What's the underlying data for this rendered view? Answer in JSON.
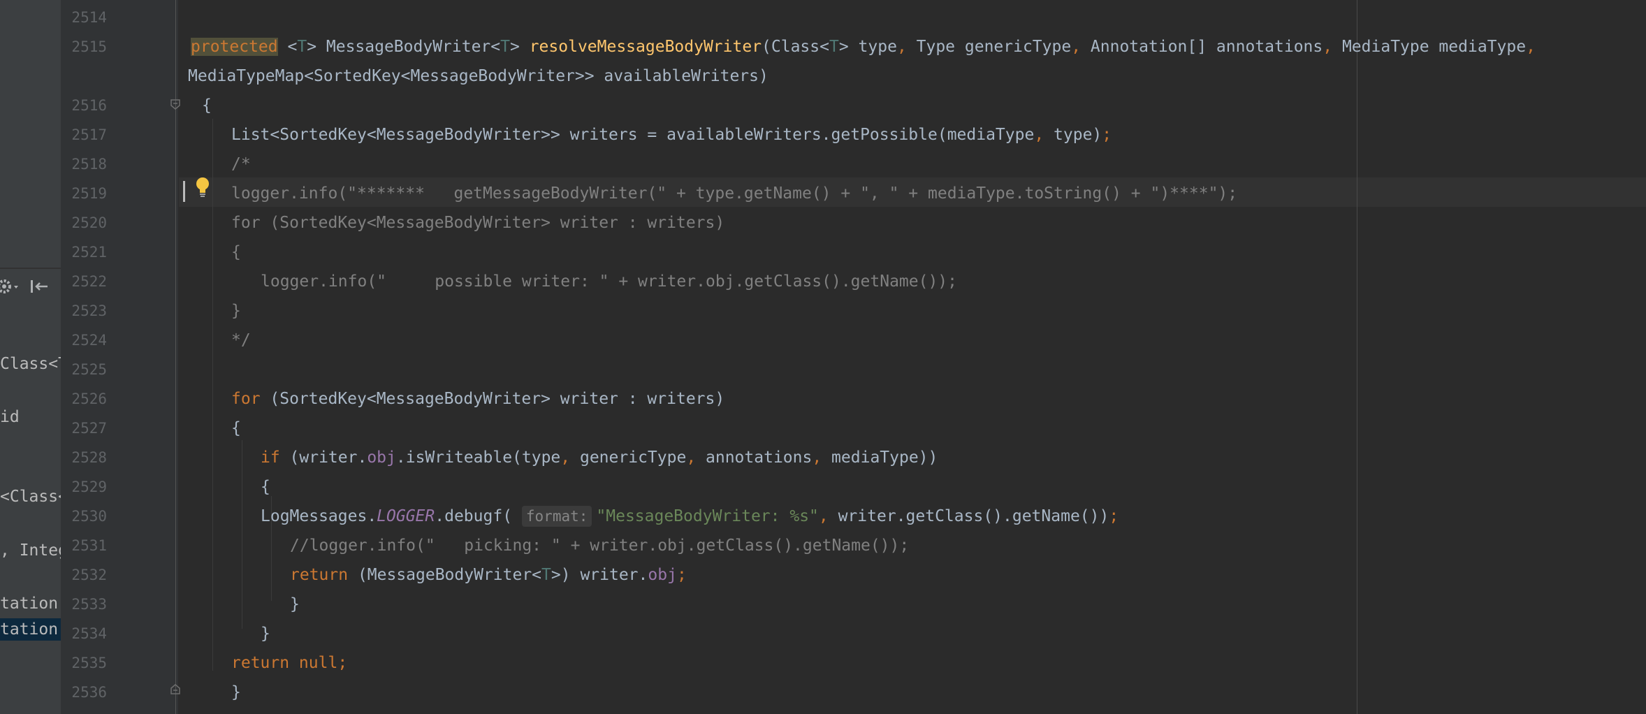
{
  "side_panel": {
    "items": [
      {
        "text": "Class<T"
      },
      {
        "text": "id"
      },
      {
        "text": "<Class<"
      },
      {
        "text": ", Integ"
      },
      {
        "text": "tation["
      },
      {
        "text": "tation["
      }
    ],
    "toolbar": {
      "settings_icon": "gear-icon",
      "collapse_icon": "collapse-left-icon"
    }
  },
  "editor": {
    "current_line": "2519",
    "lines": [
      {
        "num": "2514"
      },
      {
        "num": "2515",
        "tokens": [
          {
            "t": "protected",
            "c": "kw-hl"
          },
          {
            "t": " <",
            "c": ""
          },
          {
            "t": "T",
            "c": "tp"
          },
          {
            "t": "> MessageBodyWriter<",
            "c": ""
          },
          {
            "t": "T",
            "c": "tp"
          },
          {
            "t": "> ",
            "c": ""
          },
          {
            "t": "resolveMessageBodyWriter",
            "c": "fn"
          },
          {
            "t": "(Class<",
            "c": ""
          },
          {
            "t": "T",
            "c": "tp"
          },
          {
            "t": "> type",
            "c": ""
          },
          {
            "t": ",",
            "c": "kw"
          },
          {
            "t": " Type genericType",
            "c": ""
          },
          {
            "t": ",",
            "c": "kw"
          },
          {
            "t": " Annotation[] annotations",
            "c": ""
          },
          {
            "t": ",",
            "c": "kw"
          },
          {
            "t": " MediaType mediaType",
            "c": ""
          },
          {
            "t": ",",
            "c": "kw"
          }
        ]
      },
      {
        "num": "",
        "tokens": [
          {
            "t": "MediaTypeMap<SortedKey<MessageBodyWriter>> availableWriters)",
            "c": ""
          }
        ]
      },
      {
        "num": "2516",
        "tokens": [
          {
            "t": "{",
            "c": ""
          }
        ]
      },
      {
        "num": "2517",
        "tokens": [
          {
            "t": "List<SortedKey<MessageBodyWriter>> writers = availableWriters.getPossible(mediaType",
            "c": ""
          },
          {
            "t": ",",
            "c": "kw"
          },
          {
            "t": " type)",
            "c": ""
          },
          {
            "t": ";",
            "c": "kw"
          }
        ]
      },
      {
        "num": "2518",
        "tokens": [
          {
            "t": "/*",
            "c": "cmt"
          }
        ]
      },
      {
        "num": "2519",
        "tokens": [
          {
            "t": "logger.info(\"*******   getMessageBodyWriter(\" + type.getName() + \", \" + mediaType.toString() + \")****\");",
            "c": "cmt"
          }
        ]
      },
      {
        "num": "2520",
        "tokens": [
          {
            "t": "for (SortedKey<MessageBodyWriter> writer : writers)",
            "c": "cmt"
          }
        ]
      },
      {
        "num": "2521",
        "tokens": [
          {
            "t": "{",
            "c": "cmt"
          }
        ]
      },
      {
        "num": "2522",
        "tokens": [
          {
            "t": "logger.info(\"     possible writer: \" + writer.obj.getClass().getName());",
            "c": "cmt"
          }
        ]
      },
      {
        "num": "2523",
        "tokens": [
          {
            "t": "}",
            "c": "cmt"
          }
        ]
      },
      {
        "num": "2524",
        "tokens": [
          {
            "t": "*/",
            "c": "cmt"
          }
        ]
      },
      {
        "num": "2525",
        "tokens": []
      },
      {
        "num": "2526",
        "tokens": [
          {
            "t": "for ",
            "c": "kw"
          },
          {
            "t": "(SortedKey<MessageBodyWriter> writer : writers)",
            "c": ""
          }
        ]
      },
      {
        "num": "2527",
        "tokens": [
          {
            "t": "{",
            "c": ""
          }
        ]
      },
      {
        "num": "2528",
        "tokens": [
          {
            "t": "if ",
            "c": "kw"
          },
          {
            "t": "(writer.",
            "c": ""
          },
          {
            "t": "obj",
            "c": "fld"
          },
          {
            "t": ".isWriteable(type",
            "c": ""
          },
          {
            "t": ",",
            "c": "kw"
          },
          {
            "t": " genericType",
            "c": ""
          },
          {
            "t": ",",
            "c": "kw"
          },
          {
            "t": " annotations",
            "c": ""
          },
          {
            "t": ",",
            "c": "kw"
          },
          {
            "t": " mediaType))",
            "c": ""
          }
        ]
      },
      {
        "num": "2529",
        "tokens": [
          {
            "t": "{",
            "c": ""
          }
        ]
      },
      {
        "num": "2530",
        "tokens": [
          {
            "t": "LogMessages.",
            "c": ""
          },
          {
            "t": "LOGGER",
            "c": "static-fld"
          },
          {
            "t": ".debugf( ",
            "c": ""
          },
          {
            "t": "format:",
            "c": "hint"
          },
          {
            "t": "\"MessageBodyWriter: %s\"",
            "c": "str"
          },
          {
            "t": ",",
            "c": "kw"
          },
          {
            "t": " writer.getClass().getName())",
            "c": ""
          },
          {
            "t": ";",
            "c": "kw"
          }
        ]
      },
      {
        "num": "2531",
        "tokens": [
          {
            "t": "//logger.info(\"   picking: \" + writer.obj.getClass().getName());",
            "c": "cmt"
          }
        ]
      },
      {
        "num": "2532",
        "tokens": [
          {
            "t": "return ",
            "c": "kw"
          },
          {
            "t": "(MessageBodyWriter<",
            "c": ""
          },
          {
            "t": "T",
            "c": "tp"
          },
          {
            "t": ">) writer.",
            "c": ""
          },
          {
            "t": "obj",
            "c": "fld"
          },
          {
            "t": ";",
            "c": "kw"
          }
        ]
      },
      {
        "num": "2533",
        "tokens": [
          {
            "t": "}",
            "c": ""
          }
        ]
      },
      {
        "num": "2534",
        "tokens": [
          {
            "t": "}",
            "c": ""
          }
        ]
      },
      {
        "num": "2535",
        "tokens": [
          {
            "t": "return null",
            "c": "kw"
          },
          {
            "t": ";",
            "c": "kw"
          }
        ]
      },
      {
        "num": "2536",
        "tokens": [
          {
            "t": "}",
            "c": ""
          }
        ]
      }
    ]
  },
  "colors": {
    "background": "#2b2b2b",
    "gutter": "#313335",
    "keyword": "#cc7832",
    "method": "#ffc66d",
    "string": "#6a8759",
    "field": "#9876aa",
    "comment": "#808080",
    "type_param": "#507874"
  }
}
